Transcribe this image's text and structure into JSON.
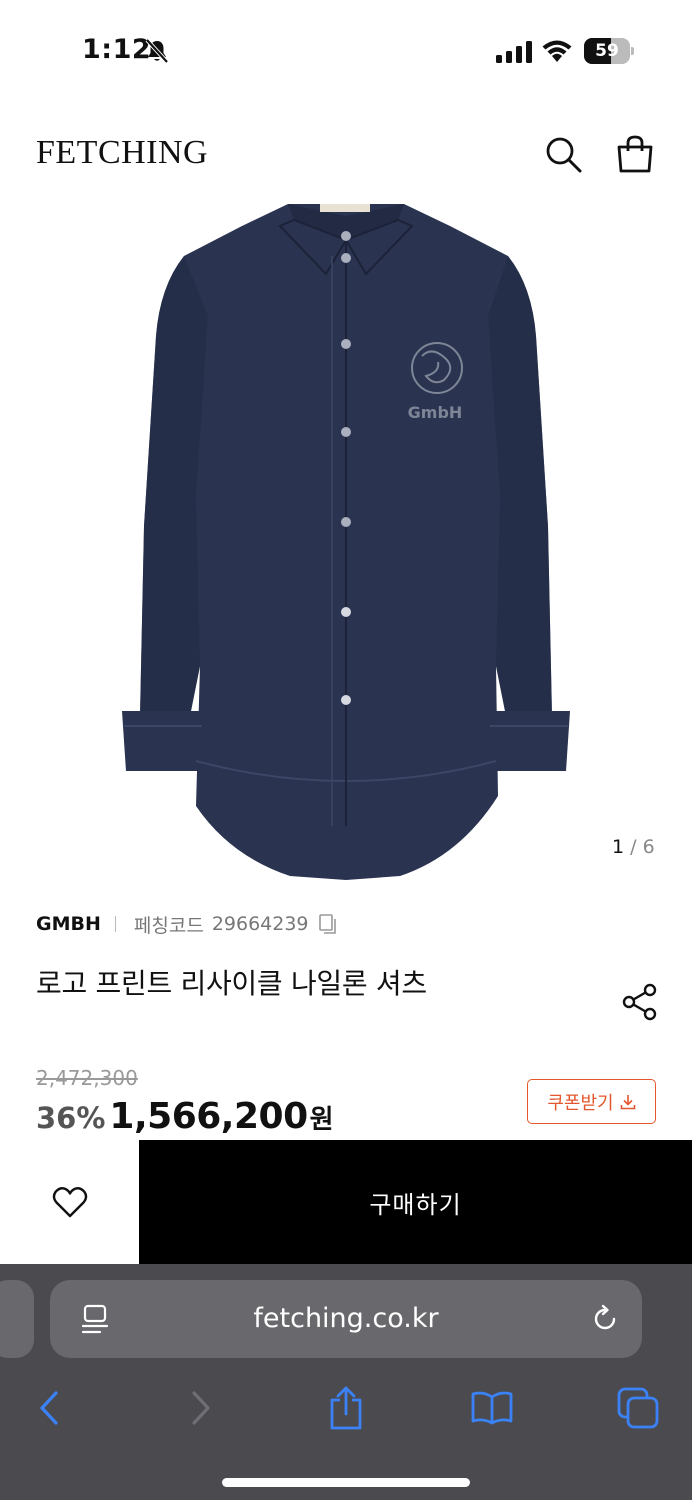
{
  "status_bar": {
    "time": "1:12",
    "battery_level": "59",
    "battery_fraction": 0.59
  },
  "header": {
    "logo": "FETCHING",
    "icons": [
      "search-icon",
      "shopping-bag-icon"
    ]
  },
  "product": {
    "image_counter_current": "1",
    "image_counter_separator": " / ",
    "image_counter_total": "6",
    "brand": "GMBH",
    "code_label": "페칭코드",
    "code_value": "29664239",
    "title": "로고 프린트 리사이클 나일론 셔츠",
    "original_price": "2,472,300",
    "discount": "36%",
    "sale_price": "1,566,200",
    "currency": "원",
    "coupon_label": "쿠폰받기",
    "shirt_color": "#2a3350",
    "logo_print_text": "GmbH"
  },
  "actions": {
    "buy_label": "구매하기",
    "wishlist_icon": "heart-icon"
  },
  "browser": {
    "url": "fetching.co.kr",
    "accent_color": "#3b82f6"
  }
}
